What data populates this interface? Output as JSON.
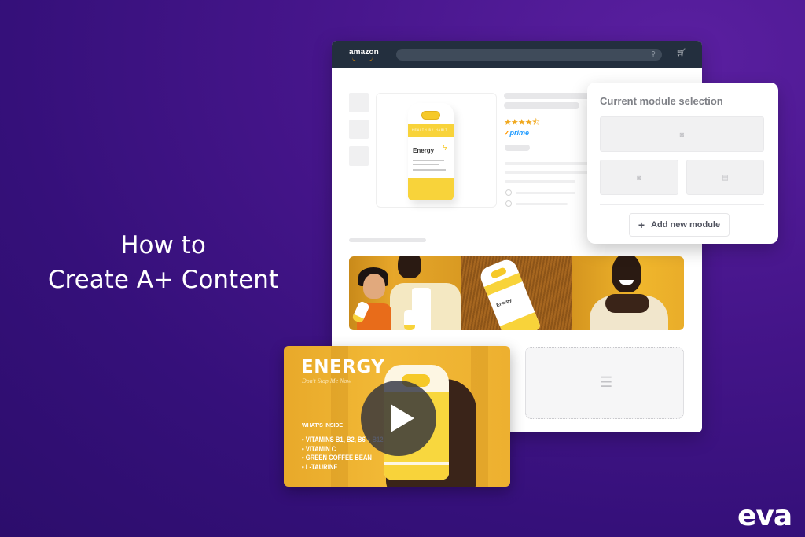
{
  "headline": {
    "line1": "How to",
    "line2": "Create A+ Content"
  },
  "amazon_window": {
    "logo_text": "amazon",
    "search": {
      "placeholder": "",
      "icon": "search-icon"
    },
    "cart_icon": "cart-icon",
    "product": {
      "bottle_label": "Energy",
      "bottle_brand_band": "HEALTH BY HABIT",
      "rating_stars": 4.5,
      "rating_glyphs": "★★★★⯪",
      "prime_check": "✓",
      "prime_label": "prime"
    },
    "lifestyle_bottle_label": "Energy",
    "dropzone_icon": "playlist-add-icon"
  },
  "module_panel": {
    "title": "Current module selection",
    "slots": [
      {
        "icon": "image-icon",
        "glyph": "◙"
      },
      {
        "icon": "image-icon",
        "glyph": "◙"
      },
      {
        "icon": "text-image-icon",
        "glyph": "▤"
      }
    ],
    "add_button": {
      "plus": "+",
      "label": "Add new module"
    }
  },
  "video_card": {
    "heading": "ENERGY",
    "tagline": "Don't Stop Me Now",
    "section_title": "WHAT'S INSIDE",
    "ingredients": [
      "• VITAMINS B1, B2, B6 + B12",
      "• VITAMIN C",
      "• GREEN COFFEE BEAN",
      "• L-TAURINE"
    ],
    "play_icon": "play-icon"
  },
  "brand": {
    "logo_text": "eva"
  },
  "colors": {
    "background": "#3a1180",
    "amazon_nav": "#232f3e",
    "amazon_orange": "#ff9900",
    "prime_blue": "#1a98ff",
    "star": "#f0a81e",
    "product_yellow": "#f8d33a"
  }
}
